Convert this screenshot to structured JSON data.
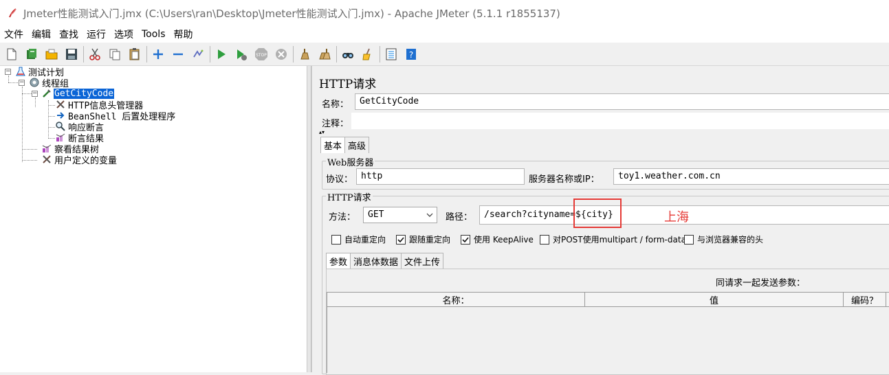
{
  "window": {
    "title": "Jmeter性能测试入门.jmx (C:\\Users\\ran\\Desktop\\Jmeter性能测试入门.jmx) - Apache JMeter (5.1.1 r1855137)"
  },
  "menubar": {
    "items": [
      "文件",
      "编辑",
      "查找",
      "运行",
      "选项",
      "Tools",
      "帮助"
    ]
  },
  "toolbar": {
    "icons": [
      "new-icon",
      "templates-icon",
      "open-icon",
      "save-icon",
      "cut-icon",
      "copy-icon",
      "paste-icon",
      "expand-icon",
      "collapse-icon",
      "toggle-icon",
      "start-icon",
      "start-no-pause-icon",
      "stop-icon",
      "shutdown-icon",
      "clear-icon",
      "clear-all-icon",
      "search-icon",
      "reset-search-icon",
      "function-helper-icon",
      "help-icon"
    ]
  },
  "tree": {
    "test_plan": "测试计划",
    "thread_group": "线程组",
    "sampler": "GetCityCode",
    "header_manager": "HTTP信息头管理器",
    "beanshell": "BeanShell 后置处理程序",
    "response_assertion": "响应断言",
    "assertion_results": "断言结果",
    "results_tree": "察看结果树",
    "user_vars": "用户定义的变量"
  },
  "panel": {
    "title": "HTTP请求",
    "name_label": "名称：",
    "name_value": "GetCityCode",
    "comment_label": "注释：",
    "comment_value": "",
    "tabs": {
      "basic": "基本",
      "advanced": "高级"
    },
    "web_server": {
      "group_title": "Web服务器",
      "protocol_label": "协议：",
      "protocol_value": "http",
      "server_label": "服务器名称或IP：",
      "server_value": "toy1.weather.com.cn"
    },
    "http_request": {
      "group_title": "HTTP请求",
      "method_label": "方法：",
      "method_value": "GET",
      "path_label": "路径：",
      "path_value": "/search?cityname=${city}",
      "annotation": "上海"
    },
    "options": {
      "auto_redirect": {
        "label": "自动重定向",
        "checked": false
      },
      "follow_redirect": {
        "label": "跟随重定向",
        "checked": true
      },
      "keepalive": {
        "label": "使用 KeepAlive",
        "checked": true
      },
      "multipart": {
        "label": "对POST使用multipart / form-data",
        "checked": false
      },
      "browser_headers": {
        "label": "与浏览器兼容的头",
        "checked": false
      }
    },
    "sub_tabs": {
      "params": "参数",
      "body": "消息体数据",
      "files": "文件上传"
    },
    "params_table": {
      "caption": "同请求一起发送参数：",
      "col_name": "名称：",
      "col_value": "值",
      "col_encode": "编码？"
    }
  },
  "colors": {
    "selection": "#0a64d6",
    "highlight_red": "#e53935"
  }
}
